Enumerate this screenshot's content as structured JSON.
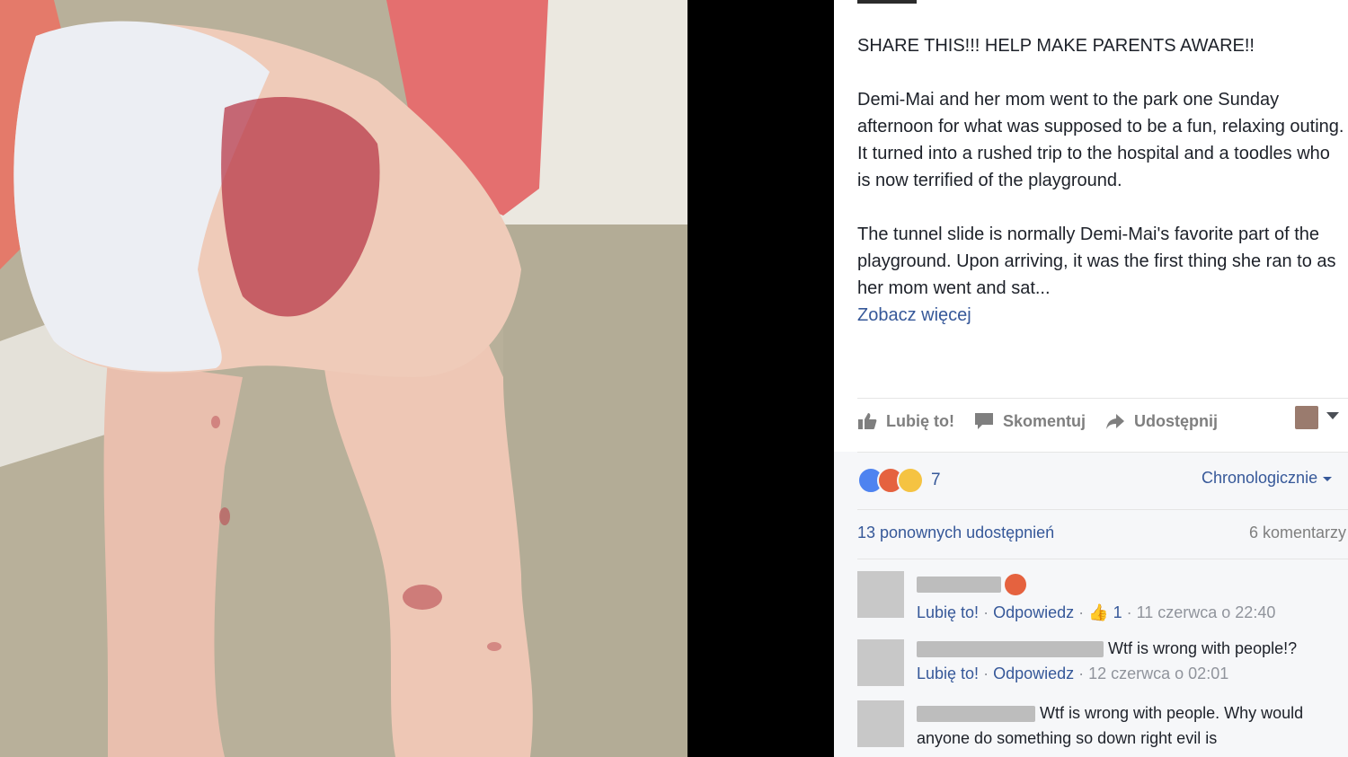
{
  "post": {
    "paragraph1": "SHARE THIS!!! HELP MAKE PARENTS AWARE!!",
    "paragraph2": "Demi-Mai and her mom went to the park one Sunday afternoon for what was supposed to be a fun, relaxing outing. It turned into a rushed trip to the hospital and a toodles who is now terrified of the playground.",
    "paragraph3": "The tunnel slide is normally Demi-Mai's favorite part of the playground. Upon arriving, it was the first thing she ran to as her mom went and sat...",
    "see_more": "Zobacz więcej"
  },
  "actions": {
    "like": "Lubię to!",
    "comment": "Skomentuj",
    "share": "Udostępnij"
  },
  "reactions": {
    "count": "7",
    "icons": [
      "like-reaction",
      "angry-reaction",
      "sad-reaction"
    ],
    "sort_label": "Chronologicznie"
  },
  "stats": {
    "shares": "13 ponownych udostępnień",
    "comments": "6 komentarzy"
  },
  "comments": [
    {
      "text": "",
      "like_label": "Lubię to!",
      "reply_label": "Odpowiedz",
      "likes": "1",
      "time": "11 czerwca o 22:40"
    },
    {
      "text": "Wtf is wrong with people!?",
      "like_label": "Lubię to!",
      "reply_label": "Odpowiedz",
      "time": "12 czerwca o 02:01"
    },
    {
      "text": "Wtf is wrong with people. Why would anyone do something so down right evil is"
    }
  ],
  "colors": {
    "link": "#365899",
    "text": "#1d2129",
    "muted": "#90949c"
  }
}
